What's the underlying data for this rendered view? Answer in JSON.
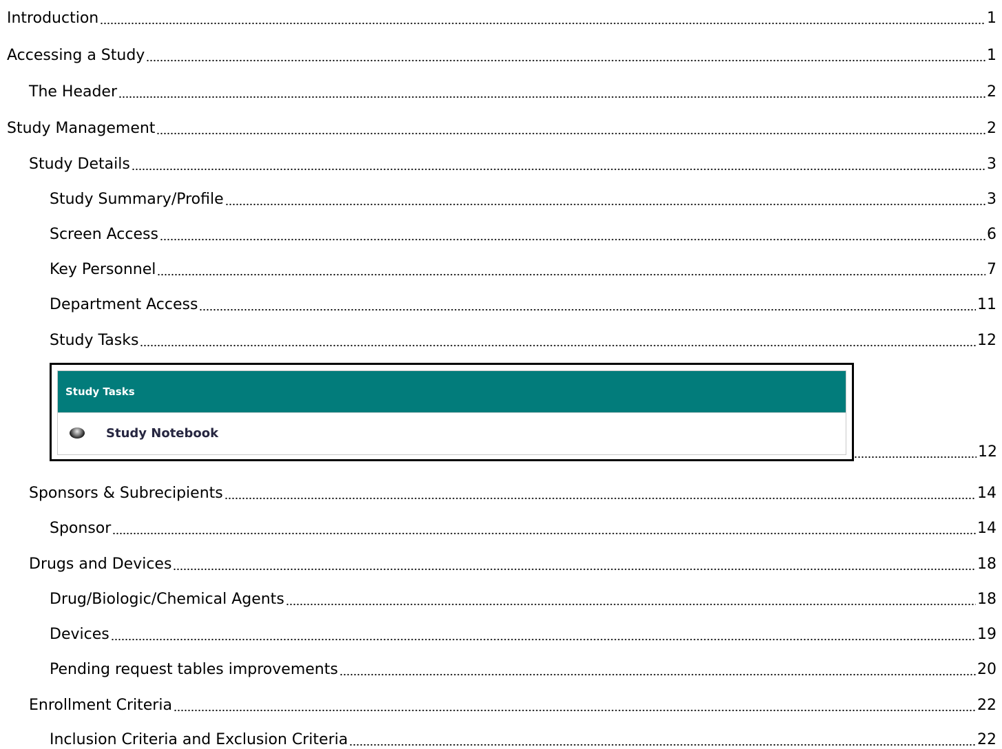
{
  "toc": {
    "entries": [
      {
        "title": "Introduction",
        "page": "1",
        "level": 1
      },
      {
        "title": "Accessing a Study",
        "page": "1",
        "level": 1
      },
      {
        "title": "The Header",
        "page": "2",
        "level": 2
      },
      {
        "title": "Study Management",
        "page": "2",
        "level": 1
      },
      {
        "title": "Study Details",
        "page": "3",
        "level": 2
      },
      {
        "title": "Study Summary/Profile",
        "page": "3",
        "level": 3
      },
      {
        "title": "Screen Access",
        "page": "6",
        "level": 3
      },
      {
        "title": "Key Personnel",
        "page": "7",
        "level": 3
      },
      {
        "title": "Department Access",
        "page": "11",
        "level": 3
      },
      {
        "title": "Study Tasks",
        "page": "12",
        "level": 3
      },
      {
        "title": "Sponsors & Subrecipients",
        "page": "14",
        "level": 2
      },
      {
        "title": "Sponsor",
        "page": "14",
        "level": 3
      },
      {
        "title": "Drugs and Devices",
        "page": "18",
        "level": 2
      },
      {
        "title": "Drug/Biologic/Chemical Agents",
        "page": "18",
        "level": 3
      },
      {
        "title": "Devices",
        "page": "19",
        "level": 3
      },
      {
        "title": "Pending request tables improvements",
        "page": "20",
        "level": 3
      },
      {
        "title": "Enrollment Criteria",
        "page": "22",
        "level": 2
      },
      {
        "title": "Inclusion Criteria and Exclusion Criteria",
        "page": "22",
        "level": 3
      }
    ],
    "figure_entry": {
      "header": "Study Tasks",
      "item_label": "Study Notebook",
      "item_icon": "radio-bullet-icon",
      "page": "12",
      "header_color": "#027c7b"
    }
  }
}
